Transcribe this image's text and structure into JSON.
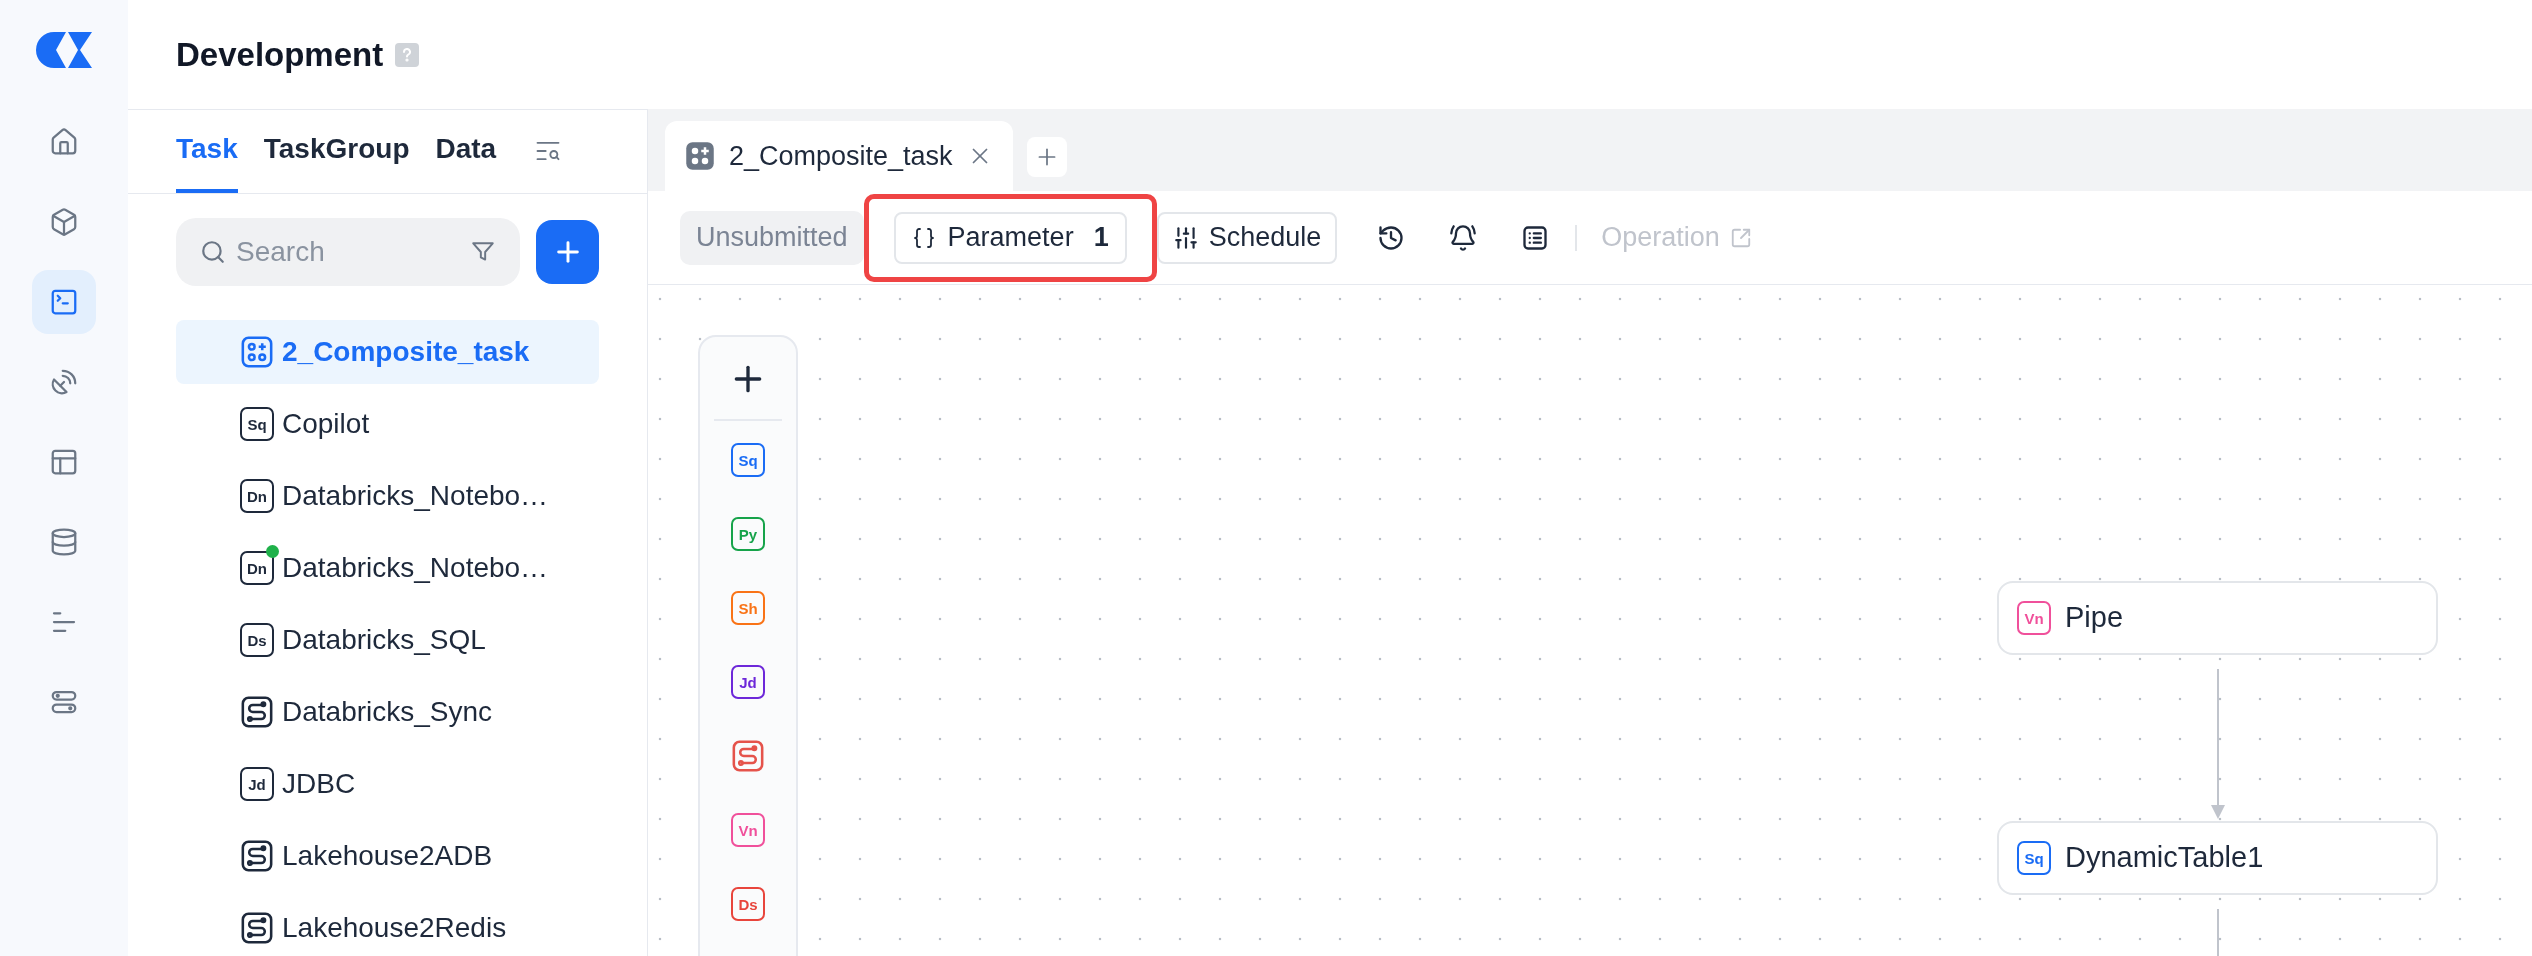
{
  "rail": {
    "items": [
      {
        "kind": "home",
        "selected": false
      },
      {
        "kind": "cube",
        "selected": false
      },
      {
        "kind": "terminal",
        "selected": true
      },
      {
        "kind": "dish",
        "selected": false
      },
      {
        "kind": "layout",
        "selected": false
      },
      {
        "kind": "database",
        "selected": false
      },
      {
        "kind": "lines",
        "selected": false
      },
      {
        "kind": "toggles",
        "selected": false
      }
    ]
  },
  "header": {
    "title": "Development"
  },
  "panel": {
    "tabs": [
      {
        "label": "Task",
        "selected": true
      },
      {
        "label": "TaskGroup",
        "selected": false
      },
      {
        "label": "Data",
        "selected": false
      }
    ],
    "search": {
      "placeholder": "Search"
    },
    "tasks": [
      {
        "label": "2_Composite_task",
        "kind": "composite",
        "selected": true,
        "status_dot": false
      },
      {
        "label": "Copilot",
        "kind": "badge",
        "badge": "Sq",
        "selected": false,
        "status_dot": false
      },
      {
        "label": "Databricks_Notebo…",
        "kind": "badge",
        "badge": "Dn",
        "selected": false,
        "status_dot": false
      },
      {
        "label": "Databricks_Notebo…",
        "kind": "badge",
        "badge": "Dn",
        "selected": false,
        "status_dot": true
      },
      {
        "label": "Databricks_SQL",
        "kind": "badge",
        "badge": "Ds",
        "selected": false,
        "status_dot": false
      },
      {
        "label": "Databricks_Sync",
        "kind": "sync",
        "selected": false,
        "status_dot": false
      },
      {
        "label": "JDBC",
        "kind": "badge",
        "badge": "Jd",
        "selected": false,
        "status_dot": false
      },
      {
        "label": "Lakehouse2ADB",
        "kind": "sync",
        "selected": false,
        "status_dot": false
      },
      {
        "label": "Lakehouse2Redis",
        "kind": "sync",
        "selected": false,
        "status_dot": false
      }
    ]
  },
  "editor": {
    "tabs": [
      {
        "label": "2_Composite_task",
        "selected": true
      }
    ],
    "toolbar": {
      "status": "Unsubmitted",
      "parameter": {
        "label": "Parameter",
        "count": "1",
        "highlighted": true
      },
      "schedule": "Schedule",
      "operation": {
        "label": "Operation",
        "disabled": true
      }
    },
    "palette": [
      {
        "kind": "badge",
        "badge": "Sq",
        "color": "#1a6cf5"
      },
      {
        "kind": "badge",
        "badge": "Py",
        "color": "#16a34a"
      },
      {
        "kind": "badge",
        "badge": "Sh",
        "color": "#f97316"
      },
      {
        "kind": "badge",
        "badge": "Jd",
        "color": "#6d28d9"
      },
      {
        "kind": "sync",
        "color": "#e5534b"
      },
      {
        "kind": "badge",
        "badge": "Vn",
        "color": "#f0509b"
      },
      {
        "kind": "badge",
        "badge": "Ds",
        "color": "#e8453c"
      }
    ],
    "nodes": [
      {
        "label": "Pipe",
        "badge": "Vn",
        "color": "#f0509b"
      },
      {
        "label": "DynamicTable1",
        "badge": "Sq",
        "color": "#1a6cf5"
      }
    ],
    "continues": true
  }
}
